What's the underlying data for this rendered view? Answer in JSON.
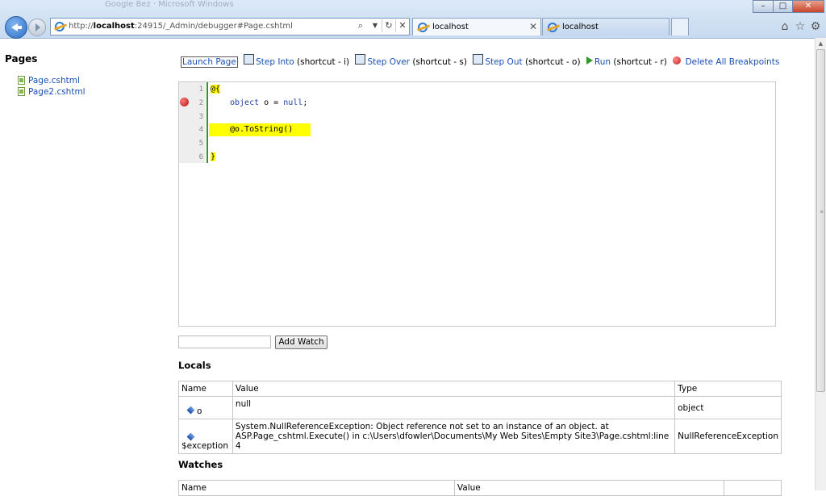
{
  "browser": {
    "title_ghost": "Google Bez · Microsoft Windows",
    "url_prefix": "http://",
    "url_host": "localhost",
    "url_rest": ":24915/_Admin/debugger#Page.cshtml",
    "tabs": [
      {
        "label": "localhost",
        "active": true
      },
      {
        "label": "localhost",
        "active": false
      }
    ],
    "window_buttons": {
      "minimize": "–",
      "maximize": "□",
      "close": "✕"
    }
  },
  "sidebar": {
    "title": "Pages",
    "pages": [
      "Page.cshtml",
      "Page2.cshtml"
    ]
  },
  "toolbar": {
    "launch": "Launch Page",
    "step_into": "Step Into",
    "step_into_hint": "(shortcut - i)",
    "step_over": "Step Over",
    "step_over_hint": "(shortcut - s)",
    "step_out": "Step Out",
    "step_out_hint": "(shortcut - o)",
    "run": "Run",
    "run_hint": "(shortcut - r)",
    "delete_bp": "Delete All Breakpoints"
  },
  "editor": {
    "line_numbers": [
      "1",
      "2",
      "3",
      "4",
      "5",
      "6"
    ],
    "lines": {
      "l1": "@{",
      "l2_kw": "object",
      "l2_rest": " o = ",
      "l2_null": "null",
      "l2_end": ";",
      "l4": "@o.ToString()",
      "l6": "}"
    },
    "breakpoint_line": 2,
    "current_line": 4
  },
  "watch": {
    "input_value": "",
    "button": "Add Watch"
  },
  "locals": {
    "title": "Locals",
    "headers": [
      "Name",
      "Value",
      "Type"
    ],
    "rows": [
      {
        "name": "o",
        "value": "null",
        "type": "object"
      },
      {
        "name": "$exception",
        "value": "System.NullReferenceException: Object reference not set to an instance of an object. at ASP.Page_cshtml.Execute() in c:\\Users\\dfowler\\Documents\\My Web Sites\\Empty Site3\\Page.cshtml:line 4",
        "type": "NullReferenceException"
      }
    ]
  },
  "watches": {
    "title": "Watches",
    "headers": [
      "Name",
      "Value",
      ""
    ]
  }
}
